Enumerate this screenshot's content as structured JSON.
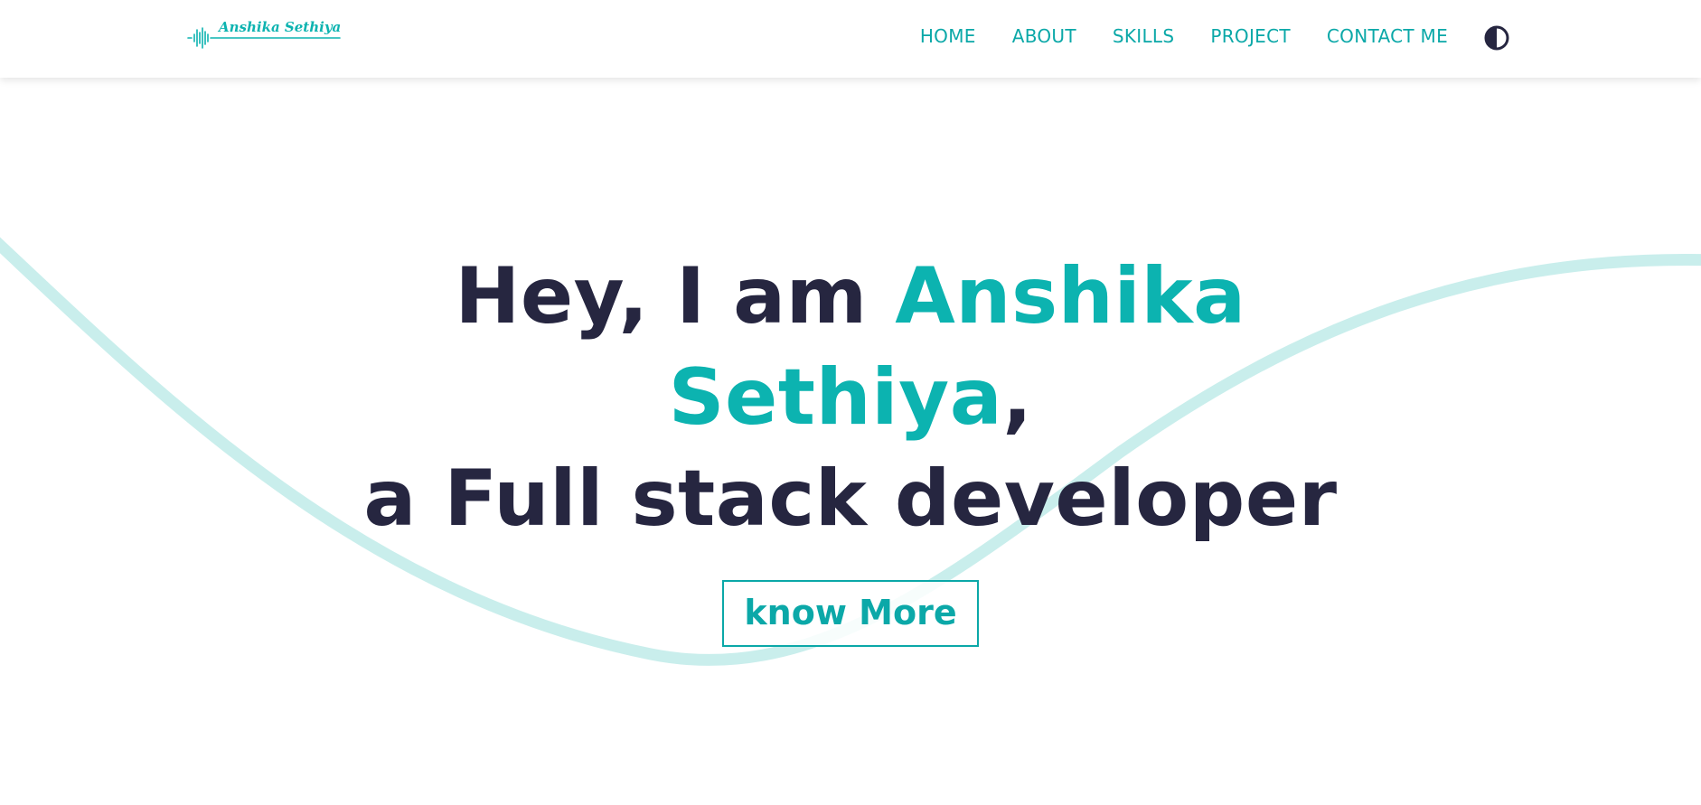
{
  "brand": {
    "logo_text": "Anshika Sethiya",
    "accent_color": "#0cb3b0",
    "dark_color": "#262640"
  },
  "nav": {
    "items": [
      {
        "label": "HOME"
      },
      {
        "label": "ABOUT"
      },
      {
        "label": "SKILLS"
      },
      {
        "label": "PROJECT"
      },
      {
        "label": "CONTACT ME"
      }
    ],
    "theme_toggle_icon": "contrast-icon"
  },
  "hero": {
    "greeting": "Hey, I am ",
    "first_name": "Anshika",
    "last_name": "Sethiya",
    "comma": ",",
    "role": "a Full stack developer"
  },
  "cta": {
    "label": "know More"
  }
}
